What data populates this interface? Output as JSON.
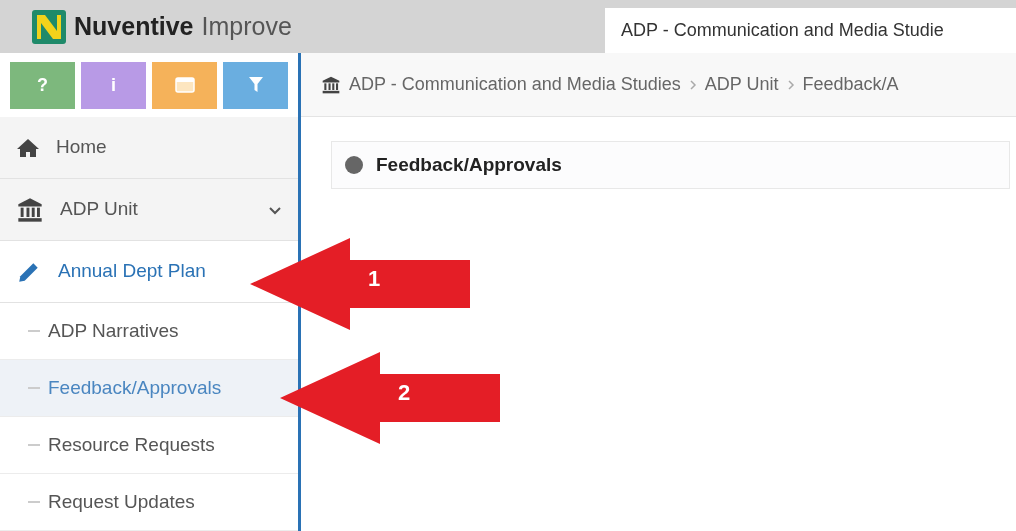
{
  "header": {
    "brand": "Nuventive",
    "product": "Improve",
    "tab_title": "ADP - Communication and Media Studie"
  },
  "toolbar": [
    {
      "kind": "text",
      "label": "?",
      "color": "#7db87d"
    },
    {
      "kind": "text",
      "label": "i",
      "color": "#b89ae6"
    },
    {
      "kind": "calendar",
      "color": "#f5b25a"
    },
    {
      "kind": "filter",
      "color": "#6aaee0"
    }
  ],
  "breadcrumb": [
    "ADP - Communication and Media Studies",
    "ADP Unit",
    "Feedback/A"
  ],
  "sidebar": {
    "items": [
      {
        "kind": "home",
        "label": "Home",
        "selected": false
      },
      {
        "kind": "unit",
        "label": "ADP Unit",
        "selected": false,
        "expanded": true
      },
      {
        "kind": "plan",
        "label": "Annual Dept Plan",
        "selected": true,
        "children": [
          {
            "label": "ADP Narratives",
            "selected": false
          },
          {
            "label": "Feedback/Approvals",
            "selected": true
          },
          {
            "label": "Resource Requests",
            "selected": false
          },
          {
            "label": "Request Updates",
            "selected": false
          }
        ]
      }
    ]
  },
  "panel": {
    "title": "Feedback/Approvals"
  },
  "annotations": [
    {
      "label": "1"
    },
    {
      "label": "2"
    }
  ]
}
